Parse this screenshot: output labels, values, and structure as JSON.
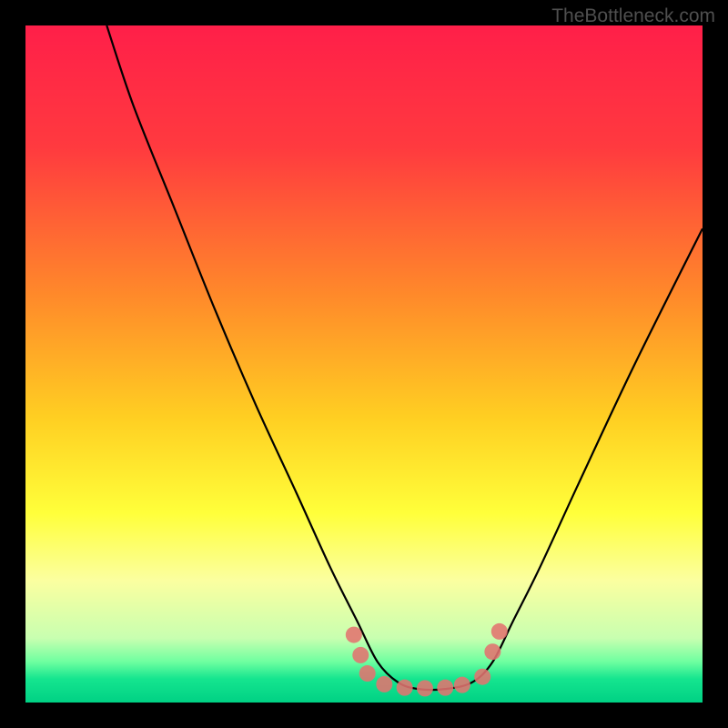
{
  "watermark": "TheBottleneck.com",
  "chart_data": {
    "type": "line",
    "title": "",
    "xlabel": "",
    "ylabel": "",
    "xlim": [
      0,
      100
    ],
    "ylim": [
      0,
      100
    ],
    "gradient_stops": [
      {
        "offset": 0,
        "color": "#ff1f49"
      },
      {
        "offset": 0.18,
        "color": "#ff3a3f"
      },
      {
        "offset": 0.4,
        "color": "#ff8a2a"
      },
      {
        "offset": 0.58,
        "color": "#ffcf22"
      },
      {
        "offset": 0.72,
        "color": "#ffff3a"
      },
      {
        "offset": 0.82,
        "color": "#fbffa0"
      },
      {
        "offset": 0.905,
        "color": "#c8ffb0"
      },
      {
        "offset": 0.94,
        "color": "#6effa0"
      },
      {
        "offset": 0.965,
        "color": "#15e58f"
      },
      {
        "offset": 1.0,
        "color": "#00d184"
      }
    ],
    "series": [
      {
        "name": "bottleneck-curve",
        "x": [
          12,
          16,
          22,
          28,
          34,
          40,
          45,
          49,
          52,
          55,
          58,
          62,
          66,
          69,
          72,
          76,
          82,
          90,
          100
        ],
        "y": [
          100,
          88,
          73,
          58,
          44,
          31,
          20,
          12,
          6,
          3,
          2,
          2,
          3,
          6,
          12,
          20,
          33,
          50,
          70
        ]
      }
    ],
    "markers": {
      "name": "dots",
      "color": "#e2736f",
      "points": [
        {
          "x": 48.5,
          "y": 10.0
        },
        {
          "x": 49.5,
          "y": 7.0
        },
        {
          "x": 50.5,
          "y": 4.3
        },
        {
          "x": 53.0,
          "y": 2.7
        },
        {
          "x": 56.0,
          "y": 2.2
        },
        {
          "x": 59.0,
          "y": 2.1
        },
        {
          "x": 62.0,
          "y": 2.2
        },
        {
          "x": 64.5,
          "y": 2.6
        },
        {
          "x": 67.5,
          "y": 3.8
        },
        {
          "x": 69.0,
          "y": 7.5
        },
        {
          "x": 70.0,
          "y": 10.5
        }
      ]
    }
  }
}
